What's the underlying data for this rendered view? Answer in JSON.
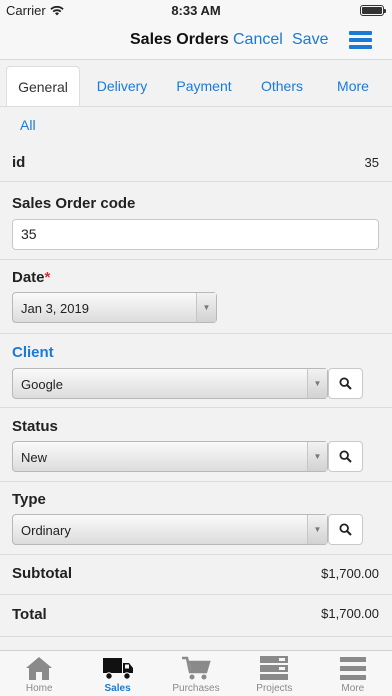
{
  "status_bar": {
    "carrier": "Carrier",
    "time": "8:33 AM",
    "battery_level": 1.0
  },
  "nav": {
    "title": "Sales Orders",
    "cancel_label": "Cancel",
    "save_label": "Save",
    "menu_icon": "hamburger-icon"
  },
  "tabs": [
    {
      "label": "General",
      "active": true
    },
    {
      "label": "Delivery",
      "active": false
    },
    {
      "label": "Payment",
      "active": false
    },
    {
      "label": "Others",
      "active": false
    },
    {
      "label": "More",
      "active": false
    }
  ],
  "tab_all": "All",
  "form": {
    "id": {
      "label": "id",
      "value": "35"
    },
    "code": {
      "label": "Sales Order code",
      "value": "35"
    },
    "date": {
      "label": "Date",
      "required_mark": "*",
      "value": "Jan 3, 2019"
    },
    "client": {
      "label": "Client",
      "value": "Google"
    },
    "status": {
      "label": "Status",
      "value": "New"
    },
    "type": {
      "label": "Type",
      "value": "Ordinary"
    },
    "subtotal": {
      "label": "Subtotal",
      "value": "$1,700.00"
    },
    "total": {
      "label": "Total",
      "value": "$1,700.00"
    }
  },
  "tabbar": [
    {
      "label": "Home",
      "icon": "home-icon",
      "active": false
    },
    {
      "label": "Sales",
      "icon": "truck-icon",
      "active": true
    },
    {
      "label": "Purchases",
      "icon": "cart-icon",
      "active": false
    },
    {
      "label": "Projects",
      "icon": "projects-icon",
      "active": false
    },
    {
      "label": "More",
      "icon": "menu-icon",
      "active": false
    }
  ],
  "colors": {
    "accent": "#1a7ad6",
    "required": "#cc3333"
  }
}
